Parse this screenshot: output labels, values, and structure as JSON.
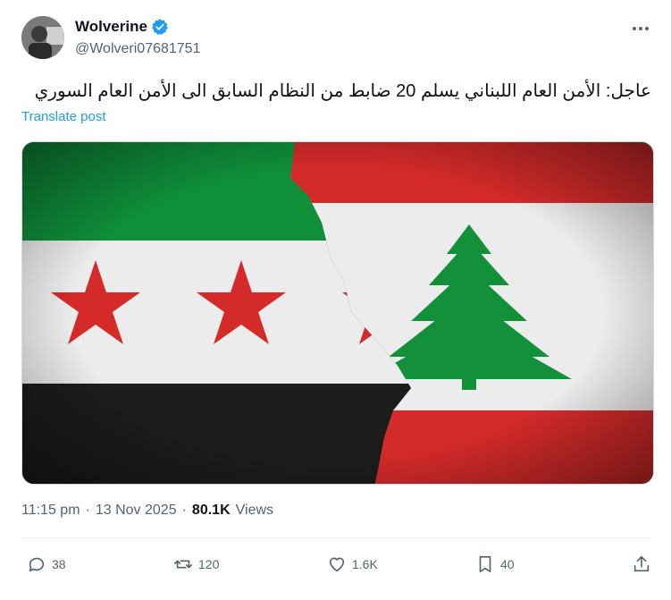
{
  "author": {
    "name": "Wolverine",
    "handle": "@Wolveri07681751",
    "verified": true
  },
  "post": {
    "text": "عاجل: الأمن العام اللبناني يسلم 20 ضابط من النظام السابق الى الأمن العام السوري",
    "translate_label": "Translate post",
    "time": "11:15 pm",
    "date": "13 Nov 2025",
    "views_count": "80.1K",
    "views_label": "Views"
  },
  "actions": {
    "replies": "38",
    "reposts": "120",
    "likes": "1.6K",
    "bookmarks": "40"
  },
  "colors": {
    "verified": "#1d9bf0",
    "link": "#1d9bf0",
    "muted": "#536471",
    "syria_green": "#0f8f3a",
    "lebanon_red": "#d42a2a",
    "cedar": "#13913a"
  }
}
